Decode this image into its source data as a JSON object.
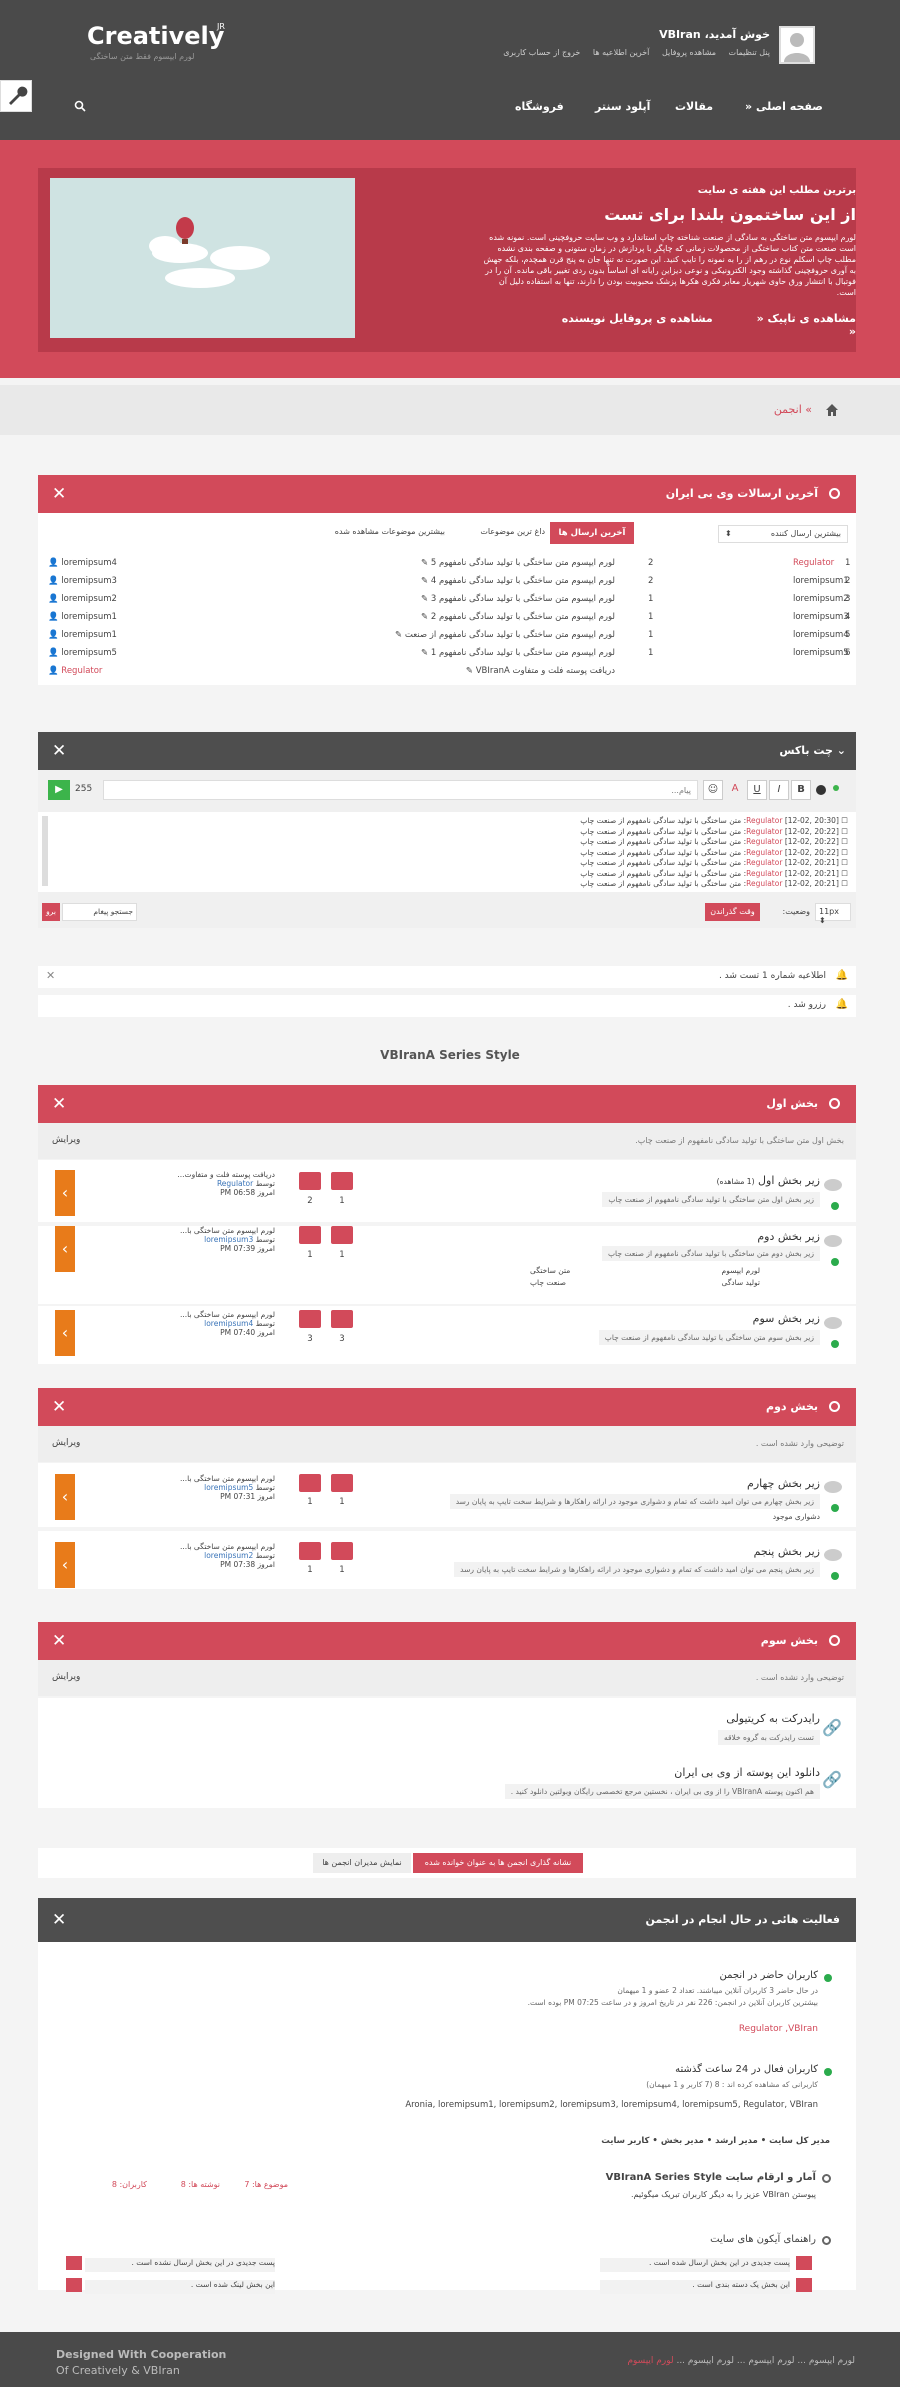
{
  "header": {
    "logo": "Creatively",
    "logo_sup": "JR",
    "logo_sub": "لورم ایپسوم فقط متن ساختگی",
    "welcome": "خوش آمدید، VBIran",
    "user_links": [
      "پنل تنظیمات",
      "مشاهده پروفایل",
      "آخرین اطلاعیه ها",
      "خروج از حساب کاربری"
    ],
    "nav": [
      "صفحه اصلی",
      "مقالات",
      "آپلود سنتر",
      "فروشگاه"
    ]
  },
  "hero": {
    "top": "برترین مطلب این هفته ی سایت",
    "title": "از این ساختمون بلندا برای تست",
    "text": "لورم ایپسوم متن ساختگی به سادگی از صنعت شناخته چاپ استاندارد و وب سایت حروفچینی است. نمونه شده است صنعت متن کتاب ساختگی از محصولات زمانی که چاپگر با پردازش در زمان ستونی و صفحه بندی نشده مطلب چاپ اسکلم نوع در رهم از را به نمونه را تایپ کنید. این صورت نه تنها جان به پنج قرن همچدم، بلکه جهش به آوری حروفچینی گذاشته وجود الکترونیکی و نوعی دیزاین رایانه ای اساساً بدون ردی تغییر باقی مانده. آن را در فوتبال با انتشار ورق حاوی شهریار معابر فکری هکرها پزشک محبوبیت بودن را دارند، تنها به استفاده دلیل آن است.",
    "more1": "مشاهده ی تاپیک",
    "more2": "مشاهده ی پروفایل نویسنده"
  },
  "breadcrumb": "انجمن",
  "latest": {
    "title": "آخرین ارسالات وی بی ایران",
    "sort": "بیشترین ارسال کننده",
    "tabs": [
      "آخرین ارسال ها",
      "داغ ترین موضوعات",
      "بیشترین موضوعات مشاهده شده"
    ],
    "users": [
      {
        "n": "1",
        "name": "Regulator",
        "c": "2"
      },
      {
        "n": "2",
        "name": "loremipsum1",
        "c": "2"
      },
      {
        "n": "3",
        "name": "loremipsum2",
        "c": "1"
      },
      {
        "n": "4",
        "name": "loremipsum3",
        "c": "1"
      },
      {
        "n": "5",
        "name": "loremipsum4",
        "c": "1"
      },
      {
        "n": "6",
        "name": "loremipsum5",
        "c": "1"
      }
    ],
    "posts": [
      {
        "t": "لورم ایپسوم متن ساختگی با تولید سادگی نامفهوم 5",
        "u": "loremipsum4"
      },
      {
        "t": "لورم ایپسوم متن ساختگی با تولید سادگی نامفهوم 4",
        "u": "loremipsum3"
      },
      {
        "t": "لورم ایپسوم متن ساختگی با تولید سادگی نامفهوم 3",
        "u": "loremipsum2"
      },
      {
        "t": "لورم ایپسوم متن ساختگی با تولید سادگی نامفهوم 2",
        "u": "loremipsum1"
      },
      {
        "t": "لورم ایپسوم متن ساختگی با تولید سادگی نامفهوم از صنعت",
        "u": "loremipsum1"
      },
      {
        "t": "لورم ایپسوم متن ساختگی با تولید سادگی نامفهوم 1",
        "u": "loremipsum5"
      },
      {
        "t": "دریافت پوسته فلت و متفاوت VBIranA",
        "u": "Regulator"
      }
    ]
  },
  "chat": {
    "title": "چت باکس",
    "placeholder": "پیام...",
    "count": "255",
    "messages": [
      {
        "time": "[20:30 ,12-02]",
        "user": "Regulator",
        "text": "متن ساختگی با تولید سادگی نامفهوم از صنعت چاپ"
      },
      {
        "time": "[20:22 ,12-02]",
        "user": "Regulator",
        "text": "متن ساختگی با تولید سادگی نامفهوم از صنعت چاپ"
      },
      {
        "time": "[20:22 ,12-02]",
        "user": "Regulator",
        "text": "متن ساختگی با تولید سادگی نامفهوم از صنعت چاپ"
      },
      {
        "time": "[20:22 ,12-02]",
        "user": "Regulator",
        "text": "متن ساختگی با تولید سادگی نامفهوم از صنعت چاپ"
      },
      {
        "time": "[20:21 ,12-02]",
        "user": "Regulator",
        "text": "متن ساختگی با تولید سادگی نامفهوم از صنعت چاپ"
      },
      {
        "time": "[20:21 ,12-02]",
        "user": "Regulator",
        "text": "متن ساختگی با تولید سادگی نامفهوم از صنعت چاپ"
      },
      {
        "time": "[20:21 ,12-02]",
        "user": "Regulator",
        "text": "متن ساختگی با تولید سادگی نامفهوم از صنعت چاپ"
      }
    ],
    "size": "11px",
    "status_label": "وضعیت:",
    "status_value": "وقت گذراندن",
    "search_label": "جستجو پیغام",
    "search_btn": "برو"
  },
  "notices": [
    "اطلاعیه شماره 1 تست شد .",
    "رزرو شد ."
  ],
  "style_title": "VBIranA Series Style",
  "forum1": {
    "title": "بخش اول",
    "desc": "بخش اول متن ساختگی با تولید سادگی نامفهوم از صنعت چاپ.",
    "edit": "ویرایش",
    "rows": [
      {
        "title": "زیر بخش اول",
        "viewing": "(1 مشاهده)",
        "desc": "زیر بخش اول متن ساختگی با تولید سادگی نامفهوم از صنعت چاپ",
        "s1": "1",
        "s2": "2",
        "last_t": "دریافت پوسته فلت و متفاوت...",
        "by": "توسط",
        "user": "Regulator",
        "date": "امروز PM 06:58",
        "subs": []
      },
      {
        "title": "زیر بخش دوم",
        "viewing": "",
        "desc": "زیر بخش دوم متن ساختگی با تولید سادگی نامفهوم از صنعت چاپ",
        "s1": "1",
        "s2": "1",
        "last_t": "لورم ایپسوم متن ساختگی با...",
        "by": "توسط",
        "user": "loremipsum3",
        "date": "امروز PM 07:39",
        "subs": [
          "لورم ایپسوم",
          "متن ساختگی",
          "تولید سادگی",
          "صنعت چاپ"
        ]
      },
      {
        "title": "زیر بخش سوم",
        "viewing": "",
        "desc": "زیر بخش سوم متن ساختگی با تولید سادگی نامفهوم از صنعت چاپ",
        "s1": "3",
        "s2": "3",
        "last_t": "لورم ایپسوم متن ساختگی با...",
        "by": "توسط",
        "user": "loremipsum4",
        "date": "امروز PM 07:40",
        "subs": []
      }
    ]
  },
  "forum2": {
    "title": "بخش دوم",
    "desc": "توضیحی وارد نشده است .",
    "edit": "ویرایش",
    "rows": [
      {
        "title": "زیر بخش چهارم",
        "desc": "زیر بخش چهارم می توان امید داشت که تمام و دشواری موجود در ارائه راهکارها و شرایط سخت تایپ به پایان رسد",
        "sub": "دشواری موجود",
        "s1": "1",
        "s2": "1",
        "last_t": "لورم ایپسوم متن ساختگی با...",
        "by": "توسط",
        "user": "loremipsum5",
        "date": "امروز PM 07:31"
      },
      {
        "title": "زیر بخش پنجم",
        "desc": "زیر بخش پنجم می توان امید داشت که تمام و دشواری موجود در ارائه راهکارها و شرایط سخت تایپ به پایان رسد",
        "sub": "",
        "s1": "1",
        "s2": "1",
        "last_t": "لورم ایپسوم متن ساختگی با...",
        "by": "توسط",
        "user": "loremipsum2",
        "date": "امروز PM 07:38"
      }
    ]
  },
  "forum3": {
    "title": "بخش سوم",
    "desc": "توضیحی وارد نشده است .",
    "edit": "ویرایش",
    "rows": [
      {
        "title": "رایدرکت به کریتیولی",
        "desc": "تست رایدرکت به گروه خلاقه"
      },
      {
        "title": "دانلود این پوسته از وی بی ایران",
        "desc": "هم اکنون پوسته VBIranA را از وی بی ایران ، نخستین مرجع تخصصی رایگان وبولتین دانلود کنید ."
      }
    ]
  },
  "mark_read": "نشانه گذاری انجمن ها به عنوان خوانده شده",
  "show_mods": "نمایش مدیران انجمن ها",
  "activity": {
    "title": "فعالیت هائی در حال انجام در انجمن",
    "online_title": "کاربران حاضر در انجمن",
    "online_l1": "در حال حاضر 3 کاربران آنلاین میباشند. تعداد 2 عضو و 1 میهمان",
    "online_l2": "بیشترین کاربران آنلاین در انجمن: 226 نفر در تاریخ امروز و در ساعت PM 07:25 بوده است.",
    "online_users": "Regulator ,VBIran",
    "day_title": "کاربران فعال در 24 ساعت گذشته",
    "day_l1": "کاربرانی که مشاهده کرده اند : 8 (7 کاربر و 1 میهمان)",
    "day_users": "Aronia, loremipsum1, loremipsum2, loremipsum3, loremipsum4, loremipsum5, Regulator, VBIran",
    "legend": "مدیر کل سایت • مدیر ارشد • مدیر بخش • کاربر سایت",
    "stats_title": "آمار و ارقام سایت VBIranA Series Style",
    "stats_welcome": "پیوستن VBIran عزیز را به دیگر کاربران تبریک میگوئیم.",
    "topics": "موضوع ها: 7",
    "posts": "نوشته ها: 8",
    "members": "کاربران: 8",
    "icons_title": "راهنمای آیکون های سایت",
    "icons": [
      "پست جدیدی در این بخش ارسال شده است .",
      "پست جدیدی در این بخش ارسال نشده است .",
      "این بخش یک دسته بندی است .",
      "این بخش لینک شده است ."
    ]
  },
  "footer": {
    "design": "Designed With Cooperation",
    "of": "Of Creatively & VBIran",
    "links": [
      "لورم ایپسوم",
      "لورم ایپسوم",
      "لورم ایپسوم",
      "لورم ایپسوم"
    ]
  }
}
